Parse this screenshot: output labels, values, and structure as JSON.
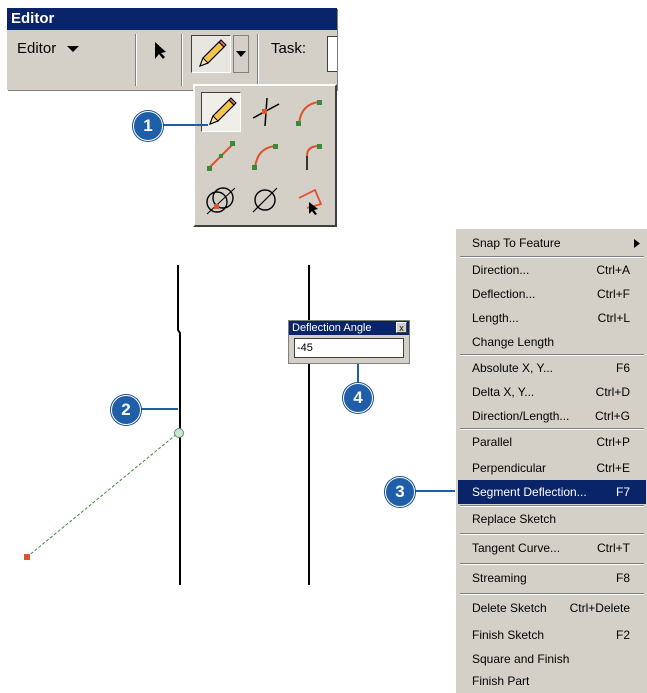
{
  "toolbar": {
    "title": "Editor",
    "editor_menu_label": "Editor",
    "task_label": "Task:"
  },
  "palette": {
    "tools": [
      "sketch-tool",
      "intersection-tool",
      "arc-tool",
      "midpoint-tool",
      "endpoint-arc-tool",
      "tangent-curve-tool",
      "trace-tool",
      "distance-distance-tool",
      "direction-distance-tool"
    ]
  },
  "callouts": [
    "1",
    "2",
    "3",
    "4"
  ],
  "deflection_dialog": {
    "title": "Deflection Angle",
    "close": "x",
    "value": "-45"
  },
  "menu": {
    "items": [
      {
        "label": "Snap To Feature",
        "shortcut": ""
      },
      {
        "label": "Direction...",
        "shortcut": "Ctrl+A"
      },
      {
        "label": "Deflection...",
        "shortcut": "Ctrl+F"
      },
      {
        "label": "Length...",
        "shortcut": "Ctrl+L"
      },
      {
        "label": "Change Length",
        "shortcut": ""
      },
      {
        "label": "Absolute X, Y...",
        "shortcut": "F6"
      },
      {
        "label": "Delta X, Y...",
        "shortcut": "Ctrl+D"
      },
      {
        "label": "Direction/Length...",
        "shortcut": "Ctrl+G"
      },
      {
        "label": "Parallel",
        "shortcut": "Ctrl+P"
      },
      {
        "label": "Perpendicular",
        "shortcut": "Ctrl+E"
      },
      {
        "label": "Segment Deflection...",
        "shortcut": "F7"
      },
      {
        "label": "Replace Sketch",
        "shortcut": ""
      },
      {
        "label": "Tangent Curve...",
        "shortcut": "Ctrl+T"
      },
      {
        "label": "Streaming",
        "shortcut": "F8"
      },
      {
        "label": "Delete Sketch",
        "shortcut": "Ctrl+Delete"
      },
      {
        "label": "Finish Sketch",
        "shortcut": "F2"
      },
      {
        "label": "Square and Finish",
        "shortcut": ""
      },
      {
        "label": "Finish Part",
        "shortcut": ""
      }
    ]
  },
  "colors": {
    "title_bar": "#0a246a",
    "callout": "#1f5ea8",
    "sketch_vertex": "#e0522e",
    "sketch_line": "#3a8a3a"
  }
}
